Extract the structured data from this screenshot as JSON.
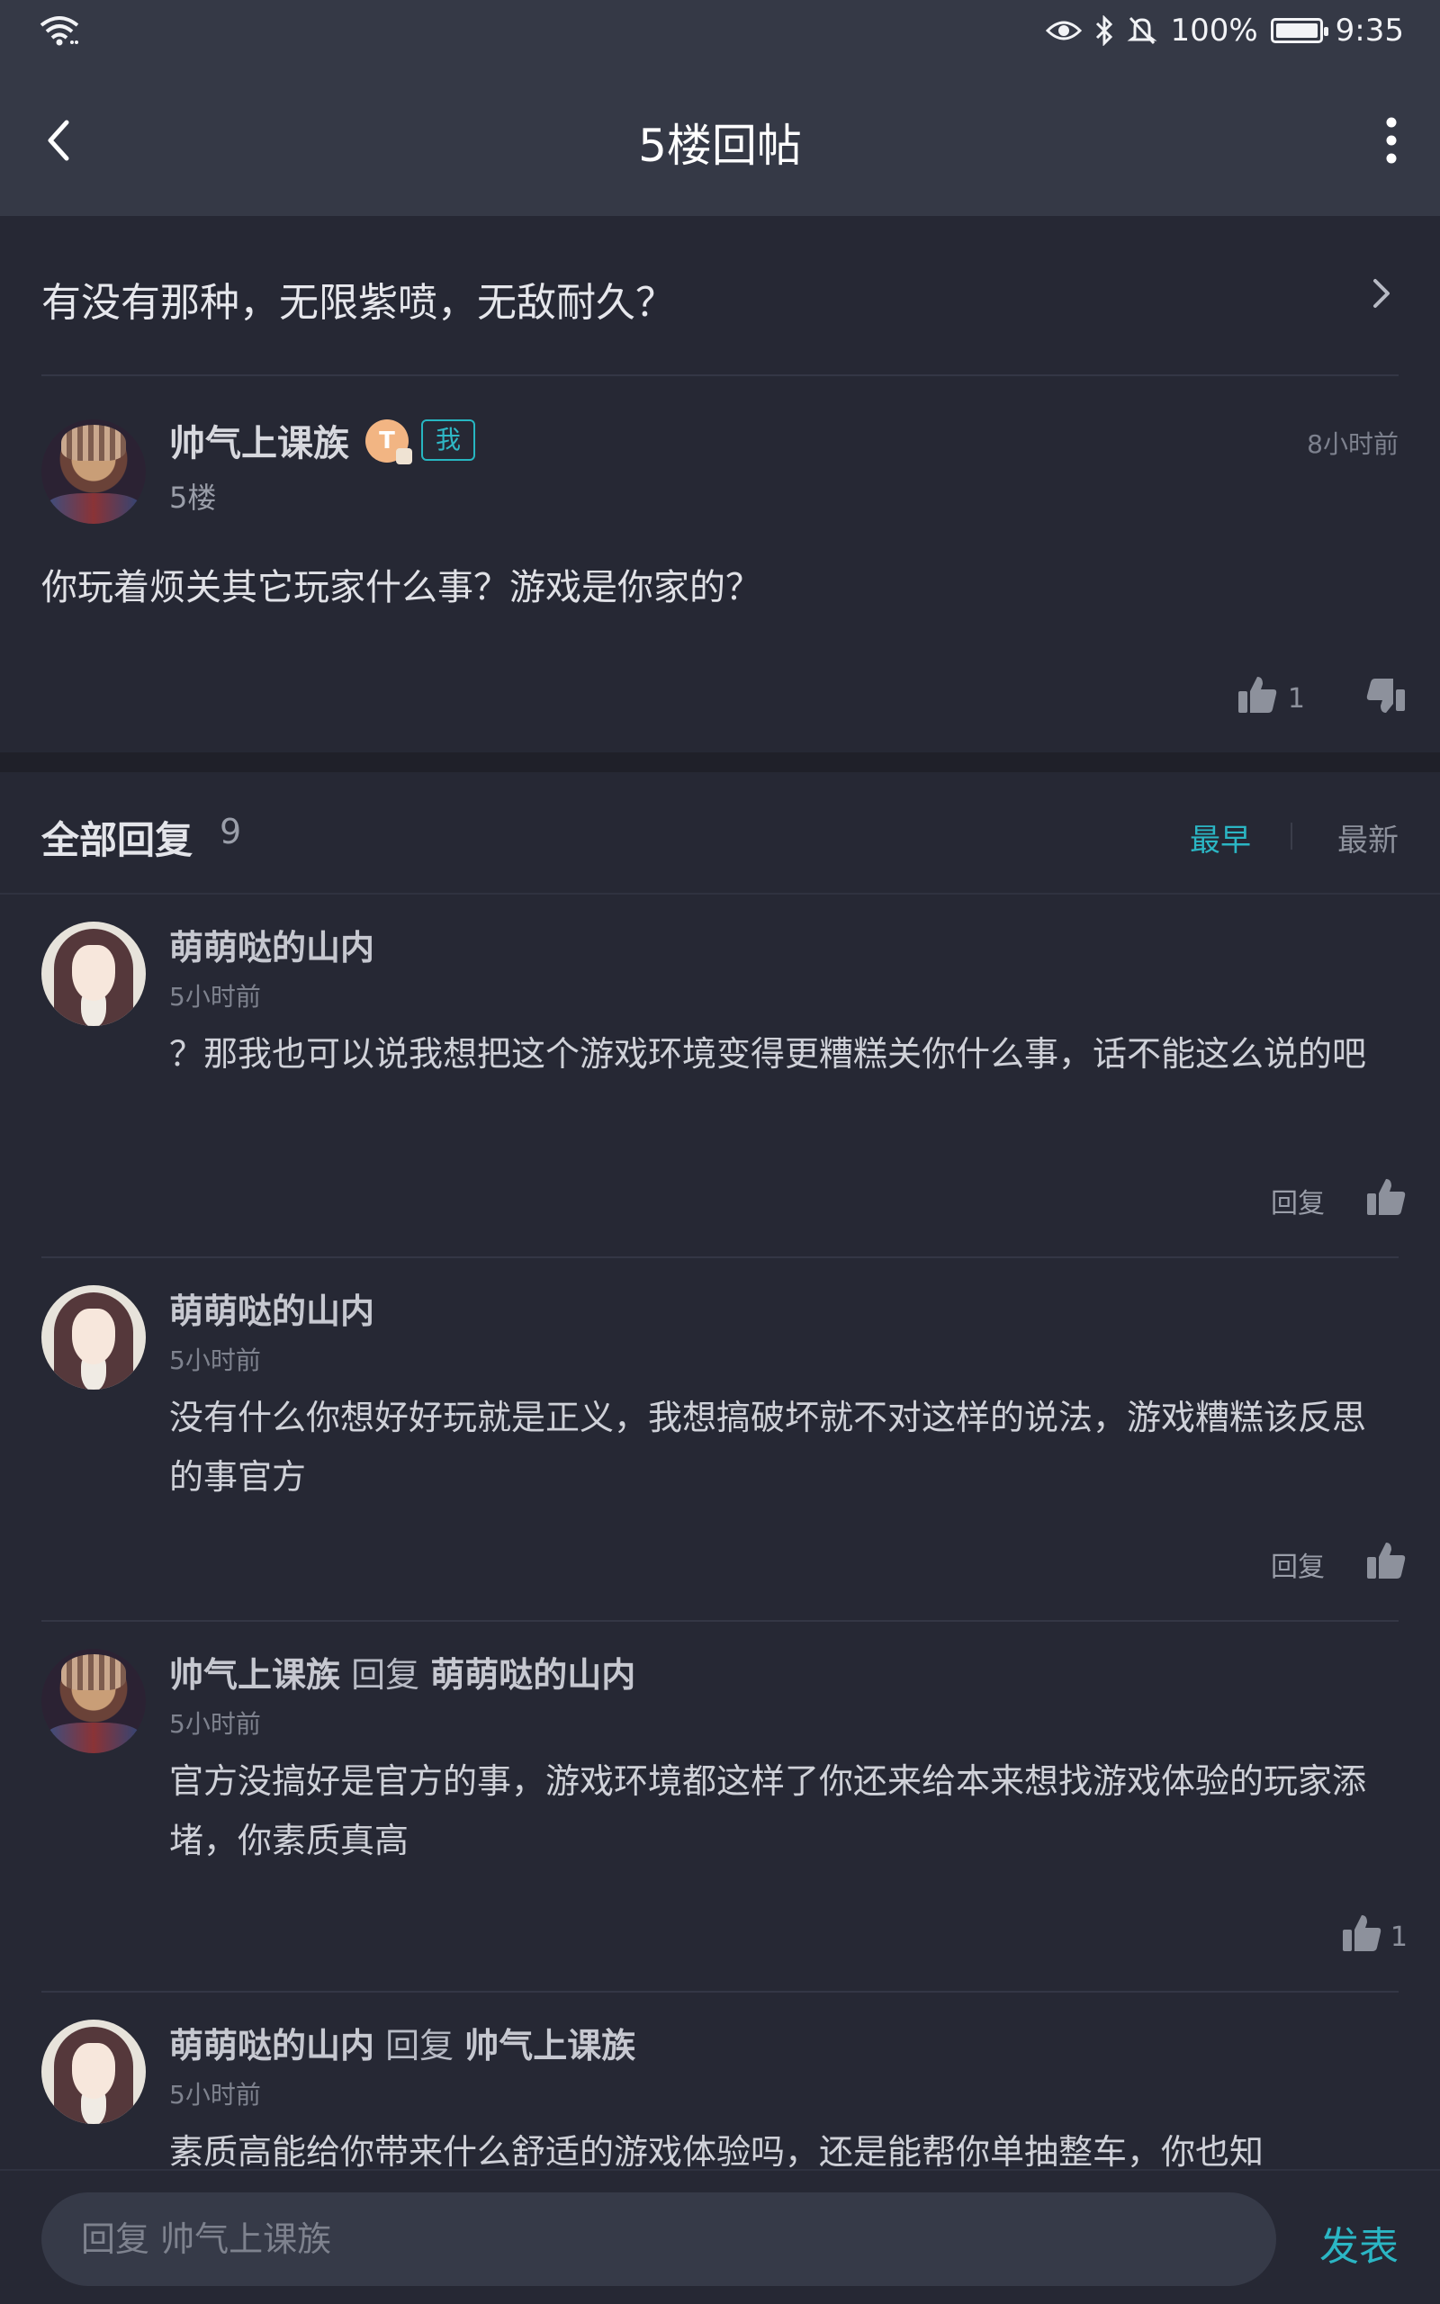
{
  "status": {
    "battery": "100%",
    "time": "9:35",
    "battery_level": 1.0
  },
  "nav": {
    "title": "5楼回帖"
  },
  "thread": {
    "title": "有没有那种，无限紫喷，无敌耐久？"
  },
  "post": {
    "author": "帅气上课族",
    "level_badge": "T",
    "me_tag": "我",
    "time": "8小时前",
    "floor": "5楼",
    "body": "你玩着烦关其它玩家什么事？游戏是你家的？",
    "likes": "1"
  },
  "replies_header": {
    "title": "全部回复",
    "count": "9",
    "sort_earliest": "最早",
    "sort_latest": "最新"
  },
  "replies": [
    {
      "author": "萌萌哒的山内",
      "time": "5小时前",
      "body": "？那我也可以说我想把这个游戏环境变得更糟糕关你什么事，话不能这么说的吧",
      "reply_label": "回复"
    },
    {
      "author": "萌萌哒的山内",
      "time": "5小时前",
      "body": "没有什么你想好好玩就是正义，我想搞破坏就不对这样的说法，游戏糟糕该反思的事官方",
      "reply_label": "回复"
    },
    {
      "author": "帅气上课族",
      "reply_word": "回复",
      "target": "萌萌哒的山内",
      "time": "5小时前",
      "body": "官方没搞好是官方的事，游戏环境都这样了你还来给本来想找游戏体验的玩家添堵，你素质真高",
      "likes": "1"
    },
    {
      "author": "萌萌哒的山内",
      "reply_word": "回复",
      "target": "帅气上课族",
      "time": "5小时前",
      "body": "素质高能给你带来什么舒适的游戏体验吗，还是能帮你单抽整车，你也知"
    }
  ],
  "bottom": {
    "input_placeholder": "回复 帅气上课族",
    "publish": "发表"
  }
}
